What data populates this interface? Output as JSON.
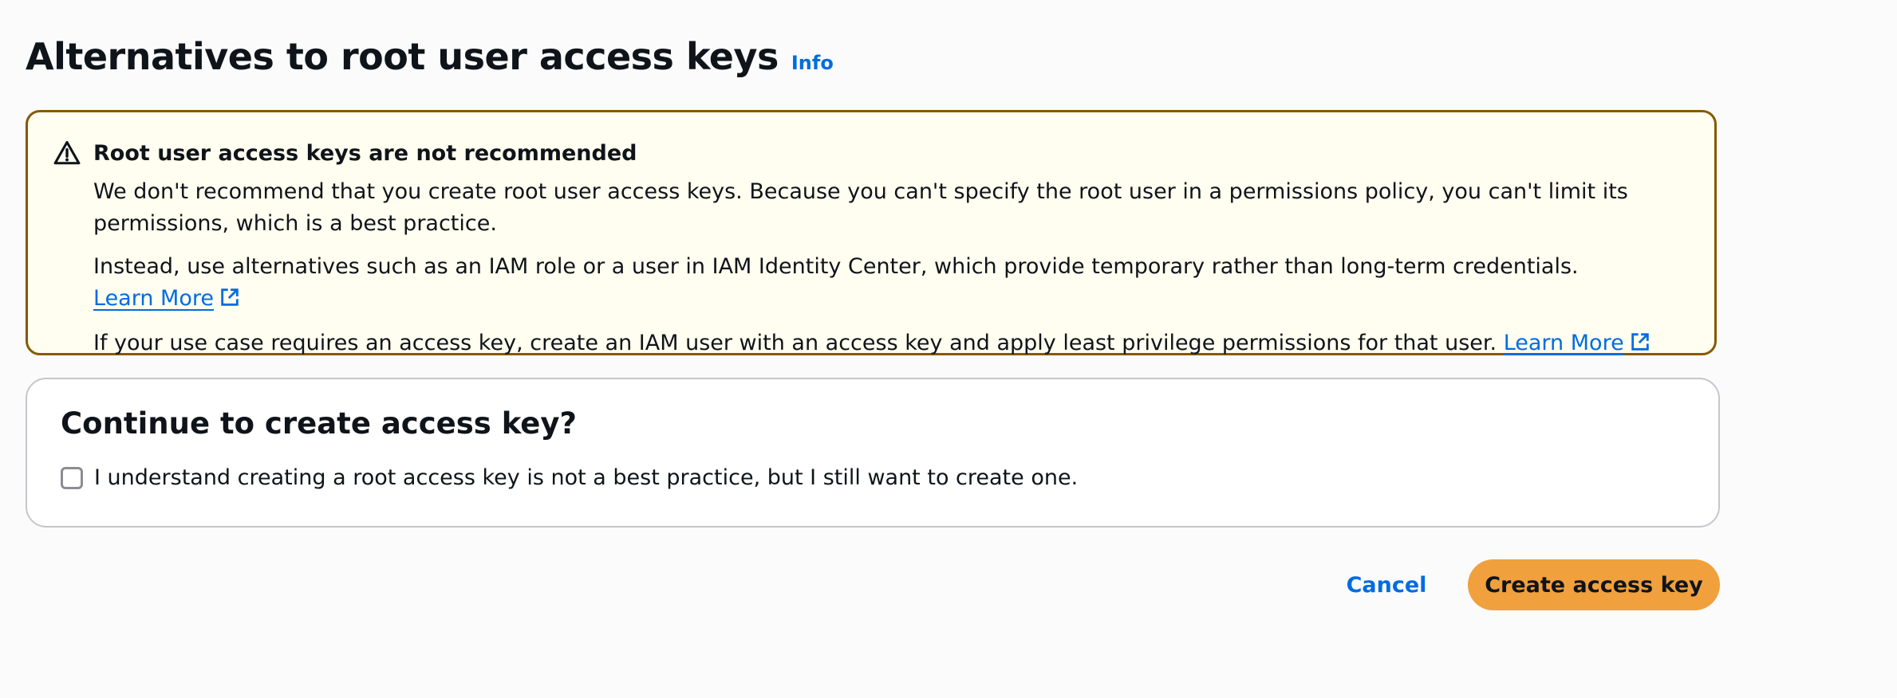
{
  "header": {
    "title": "Alternatives to root user access keys",
    "info_label": "Info"
  },
  "alert": {
    "icon": "warning-icon",
    "heading": "Root user access keys are not recommended",
    "paragraph1": "We don't recommend that you create root user access keys. Because you can't specify the root user in a permissions policy, you can't limit its permissions, which is a best practice.",
    "paragraph2": "Instead, use alternatives such as an IAM role or a user in IAM Identity Center, which provide temporary rather than long-term credentials.",
    "paragraph2_link": "Learn More",
    "paragraph3": "If your use case requires an access key, create an IAM user with an access key and apply least privilege permissions for that user.",
    "paragraph3_link": "Learn More"
  },
  "confirm": {
    "title": "Continue to create access key?",
    "checkbox_label": "I understand creating a root access key is not a best practice, but I still want to create one.",
    "checked": false
  },
  "actions": {
    "cancel_label": "Cancel",
    "primary_label": "Create access key"
  },
  "colors": {
    "link": "#006ce0",
    "warning_border": "#855900",
    "warning_bg": "#fffef0",
    "primary_button": "#f0a03c"
  }
}
